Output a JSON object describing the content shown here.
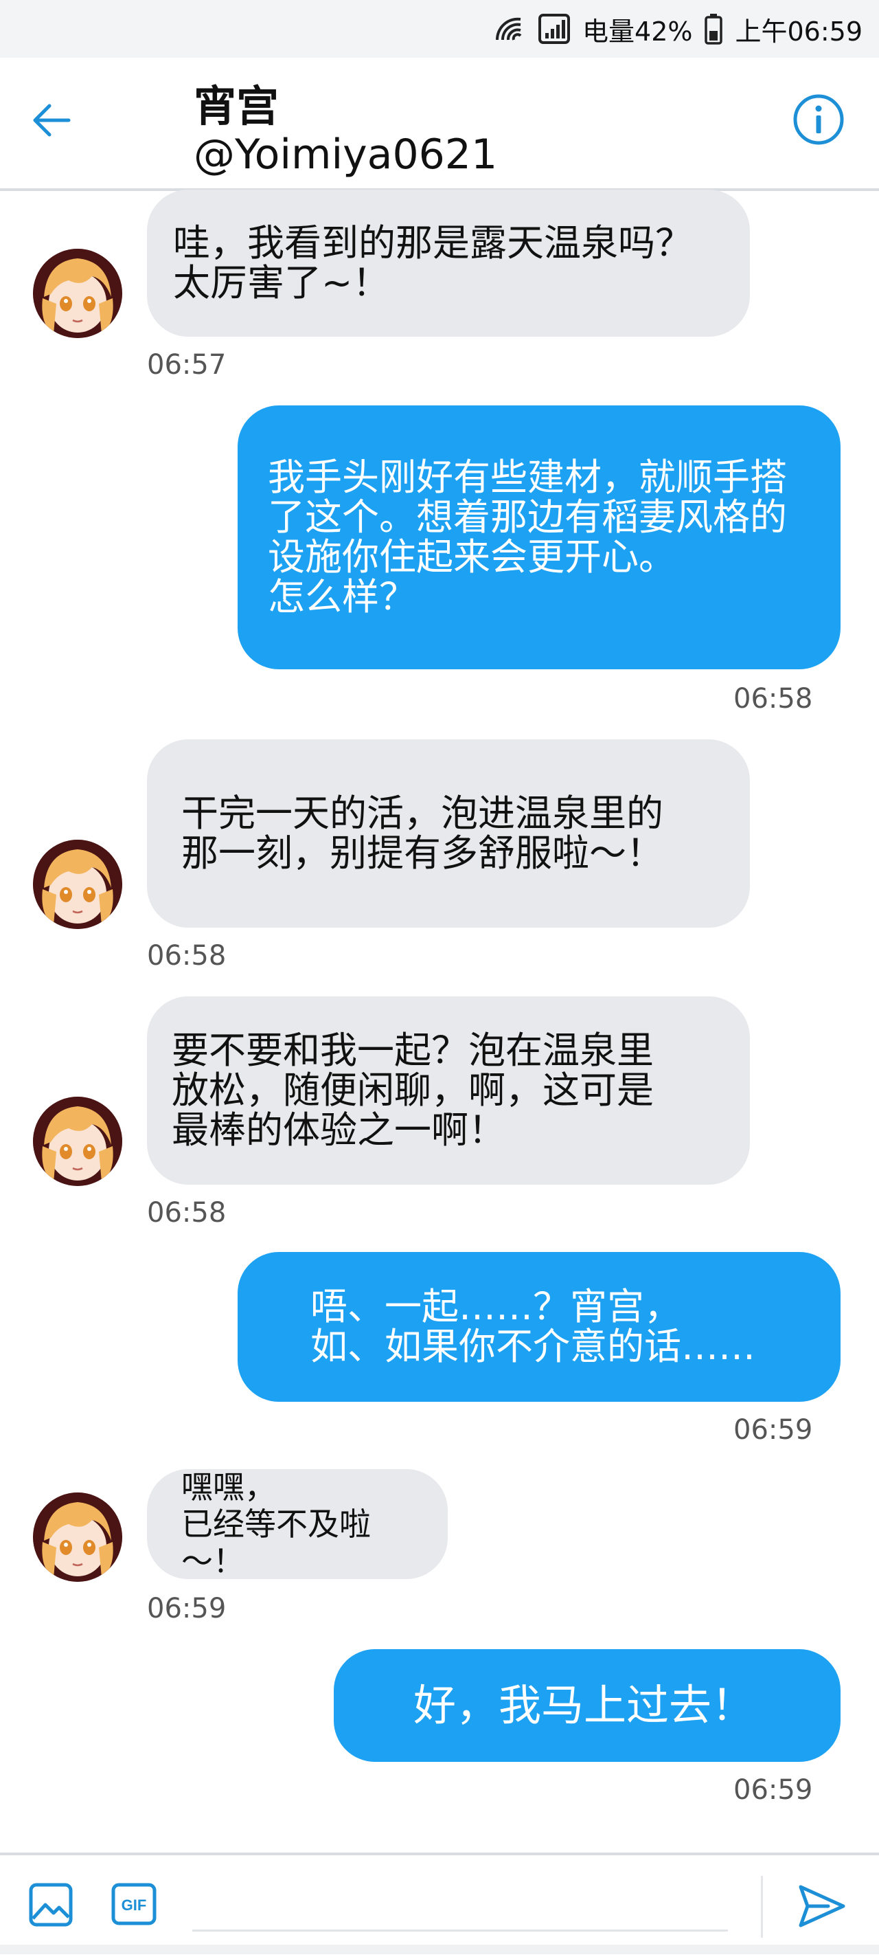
{
  "status_bar": {
    "battery_text": "电量42%",
    "time": "上午06:59",
    "icons": [
      "wifi-icon",
      "signal-icon",
      "battery-icon"
    ]
  },
  "header": {
    "name": "宵宫",
    "handle": "@Yoimiya0621",
    "back_icon": "back-arrow-icon",
    "info_icon": "info-icon"
  },
  "colors": {
    "accent": "#1da1f2",
    "incoming_bubble": "#e8e9ec",
    "outgoing_text": "#ffffff"
  },
  "messages": [
    {
      "direction": "in",
      "text": "哇，我看到的那是露天温泉吗？\n太厉害了~！",
      "time": "06:57"
    },
    {
      "direction": "out",
      "text": "我手头刚好有些建材，就顺手搭\n了这个。想着那边有稻妻风格的\n设施你住起来会更开心。\n怎么样？",
      "time": "06:58"
    },
    {
      "direction": "in",
      "text": "干完一天的活，泡进温泉里的\n那一刻，别提有多舒服啦～！",
      "time": "06:58"
    },
    {
      "direction": "in",
      "text": "要不要和我一起？泡在温泉里\n放松，随便闲聊，啊，这可是\n最棒的体验之一啊！",
      "time": "06:58"
    },
    {
      "direction": "out",
      "text": "唔、一起……？宵宫，\n如、如果你不介意的话……",
      "time": "06:59"
    },
    {
      "direction": "in",
      "text": "嘿嘿，\n已经等不及啦～！",
      "time": "06:59"
    },
    {
      "direction": "out",
      "text": "好，我马上过去！",
      "time": "06:59"
    }
  ],
  "composer": {
    "image_icon": "image-icon",
    "gif_label": "GIF",
    "input_placeholder": "",
    "send_icon": "send-icon"
  }
}
